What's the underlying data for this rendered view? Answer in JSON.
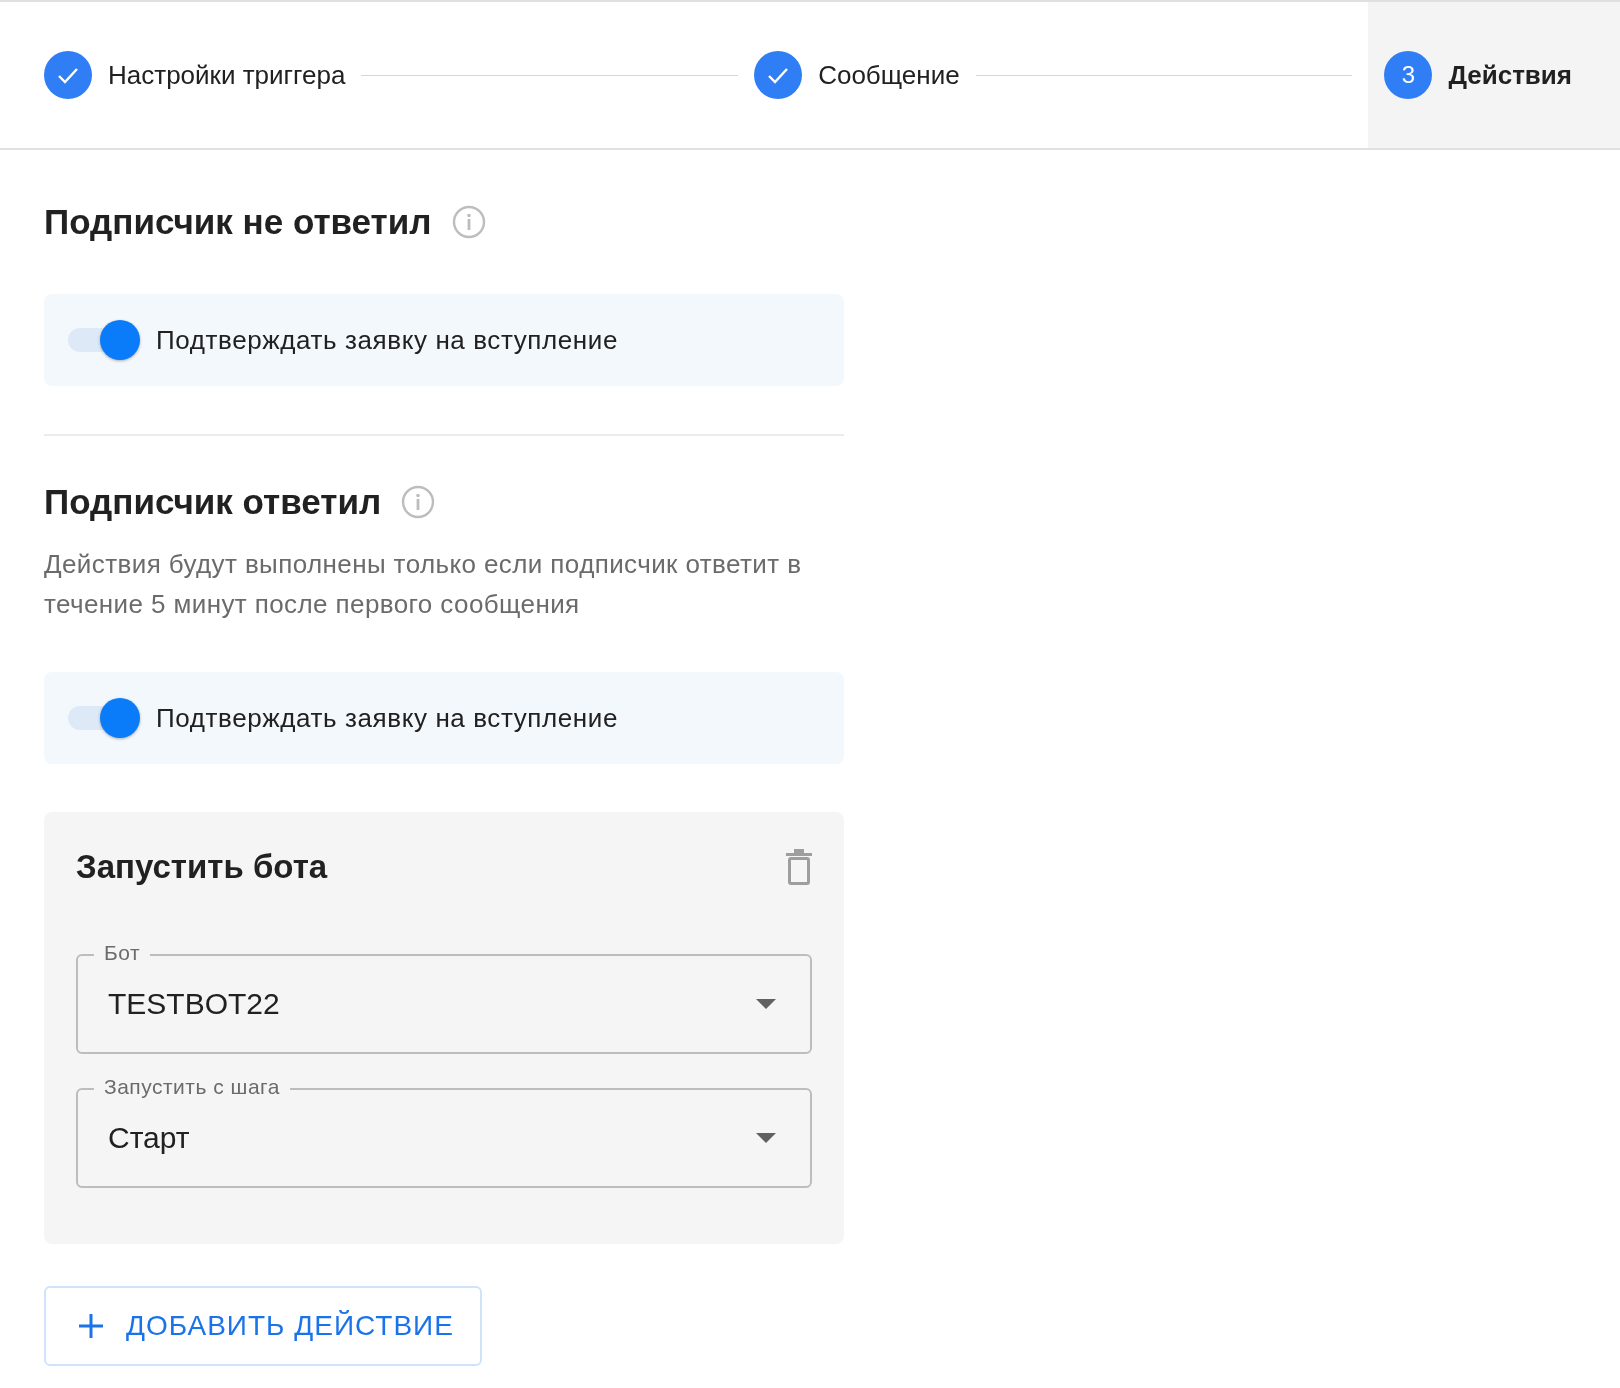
{
  "stepper": {
    "steps": [
      {
        "label": "Настройки триггера",
        "completed": true,
        "selected": false
      },
      {
        "label": "Сообщение",
        "completed": true,
        "selected": false
      },
      {
        "label": "Действия",
        "number": "3",
        "completed": false,
        "selected": true
      }
    ]
  },
  "sections": [
    {
      "title": "Подписчик не ответил",
      "toggles": [
        {
          "label": "Подтверждать заявку на вступление",
          "on": true
        }
      ]
    },
    {
      "title": "Подписчик ответил",
      "description": "Действия будут выполнены только если подписчик ответит в течение 5 минут после первого сообщения",
      "toggles": [
        {
          "label": "Подтверждать заявку на вступление",
          "on": true
        }
      ],
      "action_card": {
        "title": "Запустить бота",
        "fields": [
          {
            "label": "Бот",
            "value": "TESTBOT22"
          },
          {
            "label": "Запустить с шага",
            "value": "Старт"
          }
        ]
      }
    }
  ],
  "add_button": {
    "label": "ДОБАВИТЬ ДЕЙСТВИЕ"
  }
}
